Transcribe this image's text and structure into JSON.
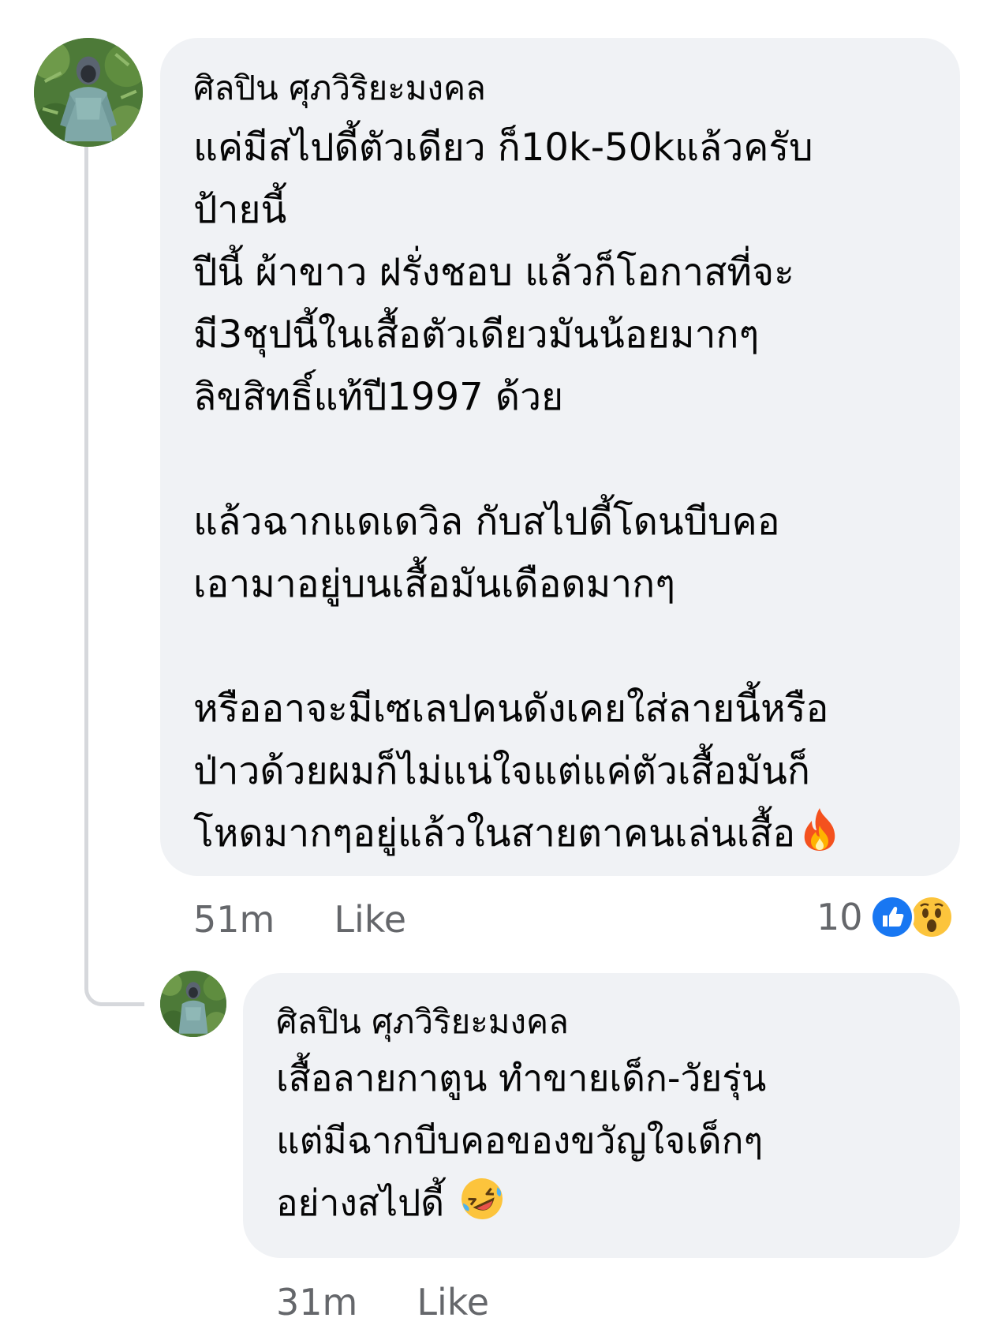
{
  "comment": {
    "author": "ศิลปิน ศุภวิริยะมงคล",
    "text": "แค่มีสไปดี้ตัวเดียว ก็10k-50kแล้วครับ\nป้ายนี้\nปีนี้  ผ้าขาว ฝรั่งชอบ แล้วก็โอกาสที่จะ\nมี3ชุปนี้ในเสื้อตัวเดียวมันน้อยมากๆ\nลิขสิทธิ์แท้ปี1997 ด้วย\n\nแล้วฉากแดเดวิล กับสไปดี้โดนบีบคอ\nเอามาอยู่บนเสื้อมันเดือดมากๆ\n\nหรืออาจะมีเซเลปคนดังเคยใส่ลายนี้หรือ\nป่าวด้วยผมก็ไม่แน่ใจแต่แค่ตัวเสื้อมันก็\nโหดมากๆอยู่แล้วในสายตาคนเล่นเสื้อ",
    "emoji": "fire-emoji",
    "time": "51m",
    "like_label": "Like",
    "reaction_count": "10",
    "reactions": [
      "like-reaction-icon",
      "wow-reaction-icon"
    ]
  },
  "reply": {
    "author": "ศิลปิน ศุภวิริยะมงคล",
    "text": "เสื้อลายกาตูน ทำขายเด็ก-วัยรุ่น\nแต่มีฉากบีบคอของขวัญใจเด็กๆ\nอย่างสไปดี้ ",
    "emoji": "rolling-laughing-emoji",
    "time": "31m",
    "like_label": "Like"
  },
  "colors": {
    "bubble": "#f0f2f5",
    "meta_text": "#65676b",
    "like_blue": "#1877f2",
    "thread_line": "#d6d8dc"
  }
}
